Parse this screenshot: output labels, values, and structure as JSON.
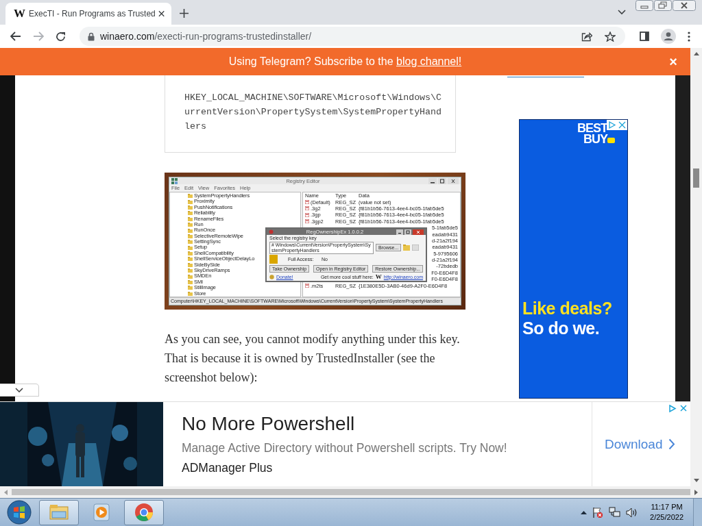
{
  "browser": {
    "tab": {
      "favicon": "W",
      "title": "ExecTI - Run Programs as Trusted",
      "selected": true
    },
    "url": {
      "host": "winaero.com",
      "path": "/execti-run-programs-trustedinstaller/"
    }
  },
  "banner": {
    "text": "Using Telegram? Subscribe to the",
    "link": "blog channel!",
    "close": "×"
  },
  "article": {
    "code": "HKEY_LOCAL_MACHINE\\SOFTWARE\\Microsoft\\Windows\\CurrentVersion\\PropertySystem\\SystemPropertyHandlers",
    "screenshot": {
      "title": "Registry Editor",
      "menu": [
        "File",
        "Edit",
        "View",
        "Favorites",
        "Help"
      ],
      "tree": [
        "SystemPropertyHandlers",
        "Proximity",
        "PushNotifications",
        "Reliability",
        "RenameFiles",
        "Run",
        "RunOnce",
        "SelectiveRemoteWipe",
        "SettingSync",
        "Setup",
        "ShellCompatibility",
        "ShellServiceObjectDelayLo",
        "SideBySide",
        "SkyDriveRamps",
        "SMDEn",
        "SMI",
        "StillImage",
        "Store"
      ],
      "columns": [
        "Name",
        "Type",
        "Data"
      ],
      "rows": [
        {
          "name": "(Default)",
          "type": "REG_SZ",
          "data": "(value not set)"
        },
        {
          "name": ".3g2",
          "type": "REG_SZ",
          "data": "{f81b1b56-7613-4ee4-bc05-1fab5de5"
        },
        {
          "name": ".3gp",
          "type": "REG_SZ",
          "data": "{f81b1b56-7613-4ee4-bc05-1fab5de5"
        },
        {
          "name": ".3gp2",
          "type": "REG_SZ",
          "data": "{f81b1b56-7613-4ee4-bc05-1fab5de5"
        },
        {
          "data": "5-1fab5de5"
        },
        {
          "data": "eadab9431"
        },
        {
          "data": "d-21a2f194"
        },
        {
          "data": "eadab9431"
        },
        {
          "data": "5-9795606"
        },
        {
          "data": "d-21a2f194"
        },
        {
          "data": "-72bdedb"
        },
        {
          "data": "F0-E6D4F8"
        },
        {
          "data": "F0-E6D4F8"
        },
        {
          "name": ".m2ts",
          "type": "REG_SZ",
          "data": "{1E380E5D-3AB0-46d9-A2F0-E6D4F8"
        }
      ],
      "status": "Computer\\HKEY_LOCAL_MACHINE\\SOFTWARE\\Microsoft\\Windows\\CurrentVersion\\PropertySystem\\SystemPropertyHandlers",
      "dialog": {
        "title": "RegOwnershipEx 1.0.0.2",
        "prompt": "Select the registry key",
        "path": "# Windows\\CurrentVersion\\PropertySystem\\SystemPropertyHandlers",
        "browse": "Browse...",
        "access_label": "Full Access:",
        "access_value": "No",
        "buttons": [
          "Take Ownership",
          "Open in Registry Editor",
          "Restore Ownership..."
        ],
        "donate": "Donate!",
        "promo": "Get more cool stuff here:",
        "promo_logo": "W",
        "promo_link": "http://winaero.com"
      }
    },
    "paragraph": "As you can see, you cannot modify anything under this key. That is because it is owned by TrustedInstaller (see the screenshot below):"
  },
  "sidebar_ad": {
    "logo": "BEST BUY",
    "headline": [
      {
        "text": "Like deals?",
        "color": "#ffe21f"
      },
      {
        "text": "So do we.",
        "color": "#ffffff"
      }
    ]
  },
  "bottom_ad": {
    "title": "No More Powershell",
    "description": "Manage Active Directory without Powershell scripts. Try Now!",
    "advertiser": "ADManager Plus",
    "cta": "Download"
  },
  "taskbar": {
    "apps": [
      {
        "kind": "explorer",
        "running": true
      },
      {
        "kind": "media",
        "running": false
      },
      {
        "kind": "chrome",
        "running": true
      }
    ],
    "time": "11:17 PM",
    "date": "2/25/2022"
  }
}
